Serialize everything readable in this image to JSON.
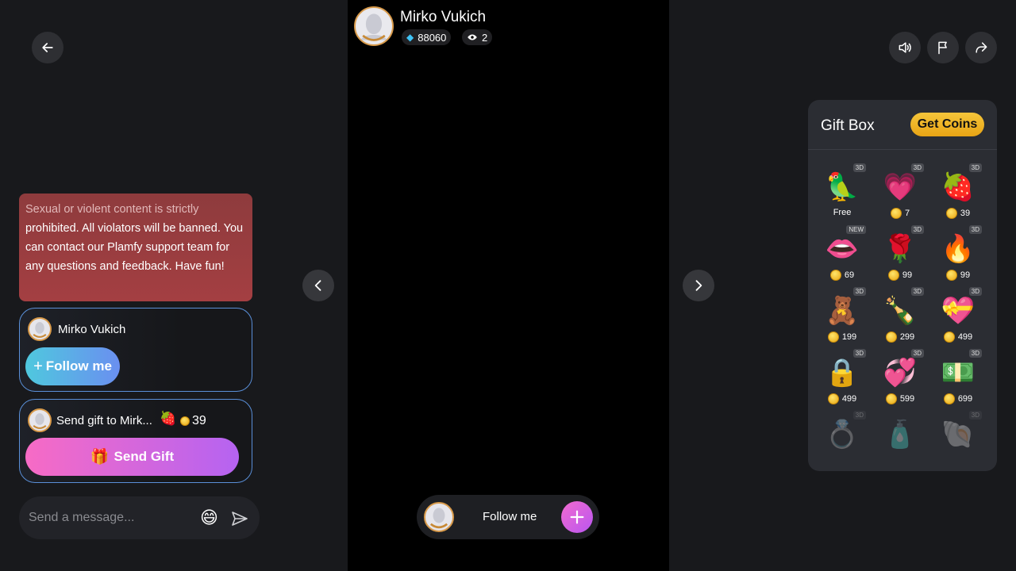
{
  "host": {
    "name": "Mirko Vukich",
    "diamonds": "88060",
    "viewers": "2"
  },
  "notice": {
    "muted": "Sexual or violent content is strictly",
    "text": "prohibited. All violators will be banned. You can contact our Plamfy support team for any questions and feedback. Have fun!"
  },
  "follow_card": {
    "name": "Mirko Vukich",
    "button": "Follow me"
  },
  "gift_card": {
    "label": "Send gift to Mirk...",
    "price": "39",
    "button": "Send Gift"
  },
  "message": {
    "placeholder": "Send a message..."
  },
  "follow_bar": {
    "label": "Follow me"
  },
  "gift_box": {
    "title": "Gift Box",
    "get_coins": "Get Coins",
    "items": [
      {
        "icon": "hi-bird",
        "badge": "3D",
        "price": "Free"
      },
      {
        "icon": "follow-heart",
        "badge": "3D",
        "price": "7"
      },
      {
        "icon": "strawberry",
        "badge": "3D",
        "price": "39"
      },
      {
        "icon": "lips",
        "badge": "NEW",
        "price": "69"
      },
      {
        "icon": "rose",
        "badge": "3D",
        "price": "99"
      },
      {
        "icon": "fire",
        "badge": "3D",
        "price": "99"
      },
      {
        "icon": "teddy-bear",
        "badge": "3D",
        "price": "199"
      },
      {
        "icon": "champagne",
        "badge": "3D",
        "price": "299"
      },
      {
        "icon": "heart-gift-box",
        "badge": "3D",
        "price": "499"
      },
      {
        "icon": "heart-lock",
        "badge": "3D",
        "price": "499"
      },
      {
        "icon": "double-hearts",
        "badge": "3D",
        "price": "599"
      },
      {
        "icon": "money-stack",
        "badge": "3D",
        "price": "699"
      },
      {
        "icon": "ring",
        "badge": "3D",
        "price": ""
      },
      {
        "icon": "perfume",
        "badge": "",
        "price": ""
      },
      {
        "icon": "shell",
        "badge": "3D",
        "price": ""
      }
    ]
  }
}
